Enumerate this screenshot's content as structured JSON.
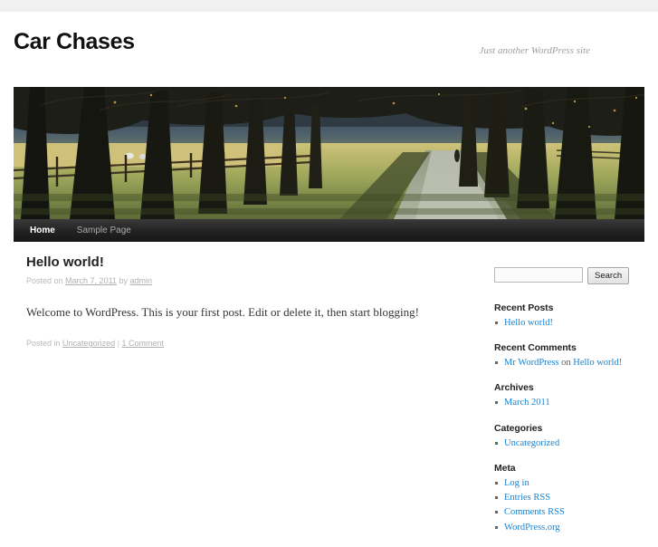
{
  "site": {
    "title": "Car Chases",
    "description": "Just another WordPress site",
    "header_image_alt": "tree-lined-avenue-header-image"
  },
  "nav": {
    "items": [
      {
        "label": "Home",
        "current": true
      },
      {
        "label": "Sample Page",
        "current": false
      }
    ]
  },
  "post": {
    "title": "Hello world!",
    "meta": {
      "posted_on_label": "Posted on",
      "date": "March 7, 2011",
      "by_label": "by",
      "author": "admin"
    },
    "content": "Welcome to WordPress. This is your first post. Edit or delete it, then start blogging!",
    "footer": {
      "posted_in_label": "Posted in",
      "category": "Uncategorized",
      "separator": "|",
      "comments": "1 Comment"
    }
  },
  "sidebar": {
    "search": {
      "value": "",
      "placeholder": "",
      "button_label": "Search"
    },
    "widgets": [
      {
        "title": "Recent Posts",
        "items": [
          {
            "link": "Hello world!"
          }
        ]
      },
      {
        "title": "Recent Comments",
        "items": [
          {
            "link": "Mr WordPress",
            "mid": " on ",
            "link2": "Hello world!"
          }
        ]
      },
      {
        "title": "Archives",
        "items": [
          {
            "link": "March 2011"
          }
        ]
      },
      {
        "title": "Categories",
        "items": [
          {
            "link": "Uncategorized"
          }
        ]
      },
      {
        "title": "Meta",
        "items": [
          {
            "link": "Log in"
          },
          {
            "link": "Entries RSS"
          },
          {
            "link": "Comments RSS"
          },
          {
            "link": "WordPress.org"
          }
        ]
      }
    ]
  },
  "colors": {
    "link": "#1982d1",
    "nav_background": "#222222",
    "text": "#373737",
    "meta_text": "#b8b8b8"
  }
}
